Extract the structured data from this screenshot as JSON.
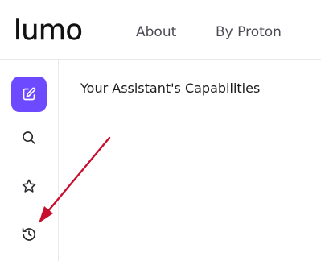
{
  "header": {
    "logo": "lumo",
    "nav": [
      {
        "label": "About"
      },
      {
        "label": "By Proton"
      }
    ]
  },
  "sidebar": {
    "items": [
      {
        "icon": "new-chat-icon",
        "active": true
      },
      {
        "icon": "search-icon"
      },
      {
        "icon": "star-icon"
      },
      {
        "icon": "history-icon"
      }
    ]
  },
  "main": {
    "title": "Your Assistant's Capabilities"
  },
  "colors": {
    "accent": "#6d4aff",
    "annotation_arrow": "#c8102e",
    "border": "#e9e9ec"
  }
}
